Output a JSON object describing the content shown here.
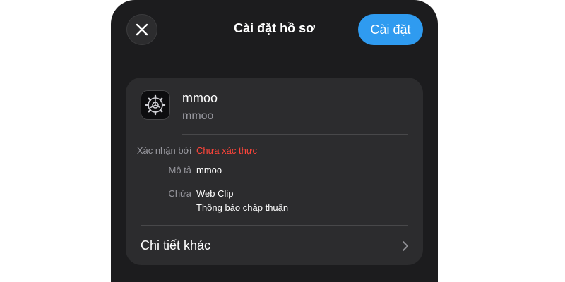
{
  "header": {
    "title": "Cài đặt hồ sơ",
    "install_label": "Cài đặt"
  },
  "profile": {
    "name": "mmoo",
    "subtitle": "mmoo",
    "icon": "gear-icon"
  },
  "details": {
    "verified_by_label": "Xác nhận bởi",
    "verified_by_value": "Chưa xác thực",
    "description_label": "Mô tả",
    "description_value": "mmoo",
    "contains_label": "Chứa",
    "contains_values": [
      "Web Clip",
      "Thông báo chấp thuận"
    ]
  },
  "more": {
    "label": "Chi tiết khác"
  },
  "colors": {
    "background": "#1c1c1e",
    "card": "#2c2c2e",
    "accent": "#2f9bf0",
    "warning": "#ff453a"
  }
}
